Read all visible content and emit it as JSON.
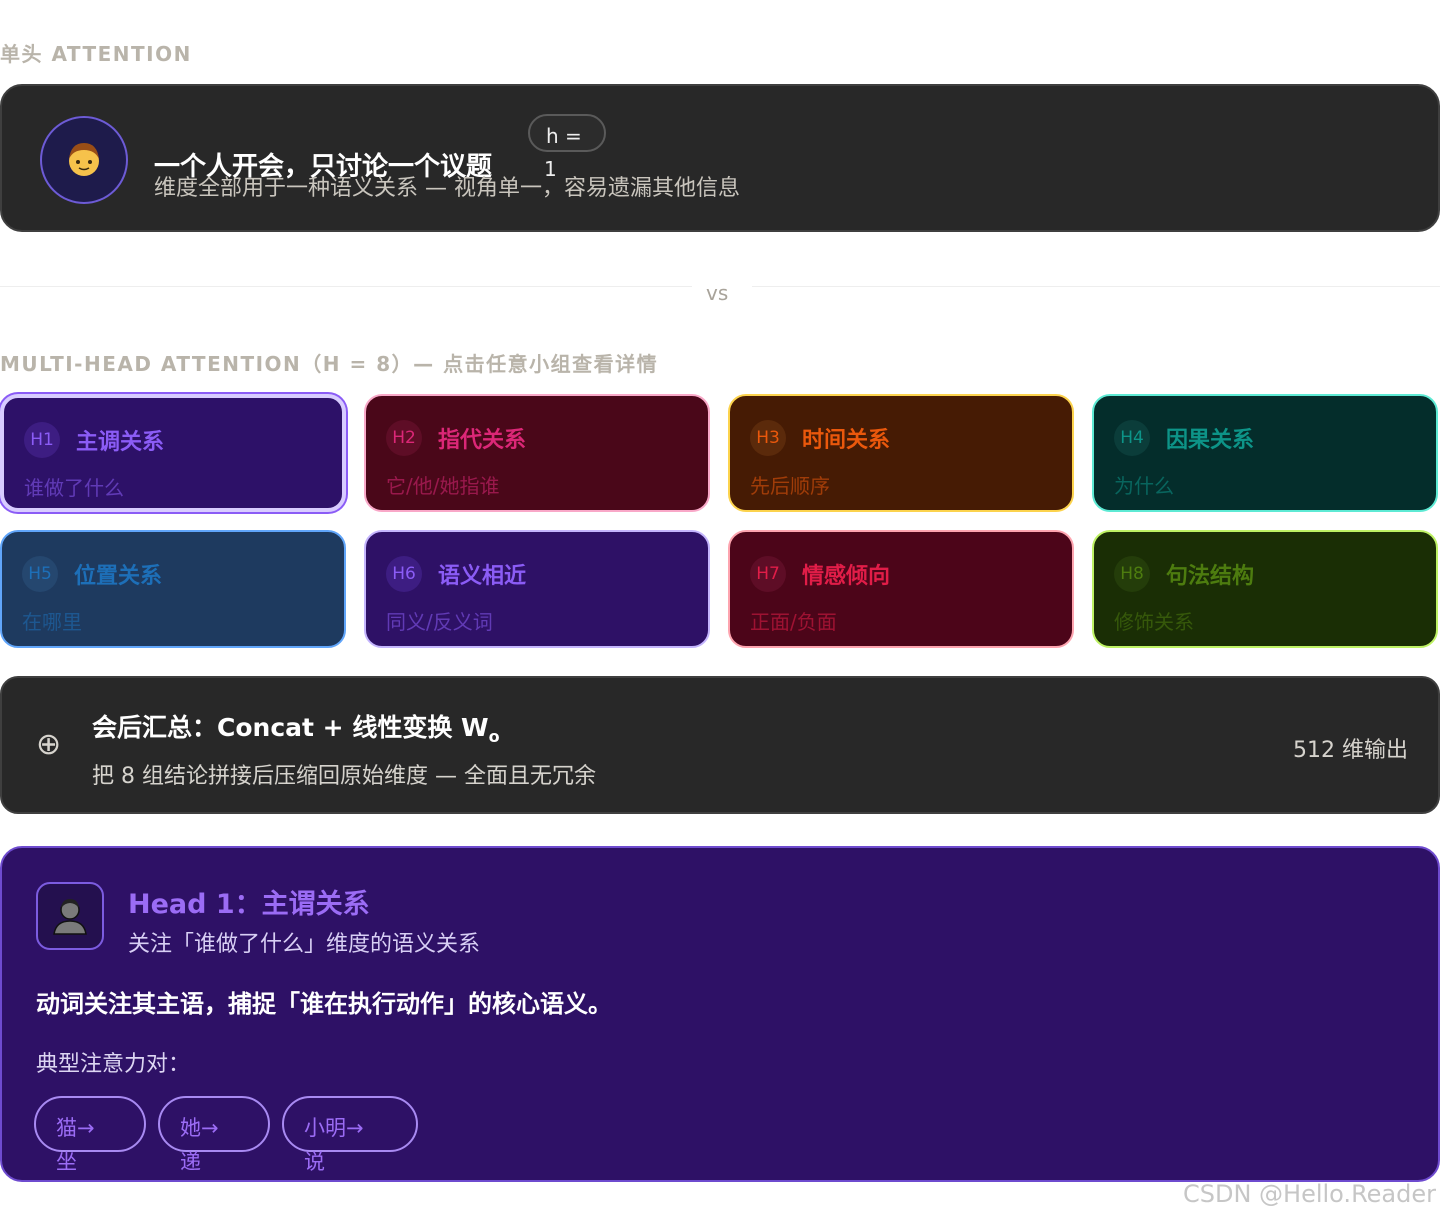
{
  "single": {
    "section_label": "单头 ATTENTION",
    "title": "一个人开会，只讨论一个议题",
    "subtitle": "维度全部用于一种语义关系 — 视角单一，容易遗漏其他信息",
    "badge_label": "h =",
    "badge_value": "1",
    "avatar_icon": "person-icon"
  },
  "divider": {
    "text": "vs"
  },
  "multi": {
    "section_label": "MULTI-HEAD ATTENTION（H = 8）— 点击任意小组查看详情",
    "heads": [
      {
        "id": "H1",
        "name": "主调关系",
        "desc": "谁做了什么",
        "bg": "#2d1168",
        "border": "#7c3aed",
        "accent": "#8b5cf6",
        "circle": "#3d1d82"
      },
      {
        "id": "H2",
        "name": "指代关系",
        "desc": "它/他/她指谁",
        "bg": "#4a0719",
        "border": "#f9a8c8",
        "accent": "#db2777",
        "circle": "#5e0d26"
      },
      {
        "id": "H3",
        "name": "时间关系",
        "desc": "先后顺序",
        "bg": "#461b04",
        "border": "#fcd34d",
        "accent": "#ea580c",
        "circle": "#5b2a0b"
      },
      {
        "id": "H4",
        "name": "因果关系",
        "desc": "为什么",
        "bg": "#042d2b",
        "border": "#5eead4",
        "accent": "#0d9488",
        "circle": "#0b3d3a"
      },
      {
        "id": "H5",
        "name": "位置关系",
        "desc": "在哪里",
        "bg": "#1e3a5f",
        "border": "#60a5fa",
        "accent": "#1d6fb8",
        "circle": "#25476f"
      },
      {
        "id": "H6",
        "name": "语义相近",
        "desc": "同义/反义词",
        "bg": "#2e1166",
        "border": "#c4b5fd",
        "accent": "#8b5cf6",
        "circle": "#3d1d82"
      },
      {
        "id": "H7",
        "name": "情感倾向",
        "desc": "正面/负面",
        "bg": "#4c0519",
        "border": "#fda4af",
        "accent": "#e11d48",
        "circle": "#5e0d26"
      },
      {
        "id": "H8",
        "name": "句法结构",
        "desc": "修饰关系",
        "bg": "#1a2e05",
        "border": "#bef264",
        "accent": "#4d7c0f",
        "circle": "#243d0a"
      }
    ]
  },
  "summary": {
    "icon": "plus-circle-icon",
    "title": "会后汇总：Concat + 线性变换 W",
    "title_sub": "o",
    "subtitle": "把 8 组结论拼接后压缩回原始维度 — 全面且无冗余",
    "right_text": "512 维输出"
  },
  "detail": {
    "avatar_icon": "person-dark-icon",
    "title": "Head 1：主谓关系",
    "subtitle": "关注「谁做了什么」维度的语义关系",
    "body": "动词关注其主语，捕捉「谁在执行动作」的核心语义。",
    "pairs_label": "典型注意力对：",
    "pairs": [
      {
        "top": "猫→",
        "bottom": "坐"
      },
      {
        "top": "她→",
        "bottom": "递"
      },
      {
        "top": "小明→",
        "bottom": "说"
      }
    ]
  },
  "watermark": "CSDN @Hello.Reader"
}
